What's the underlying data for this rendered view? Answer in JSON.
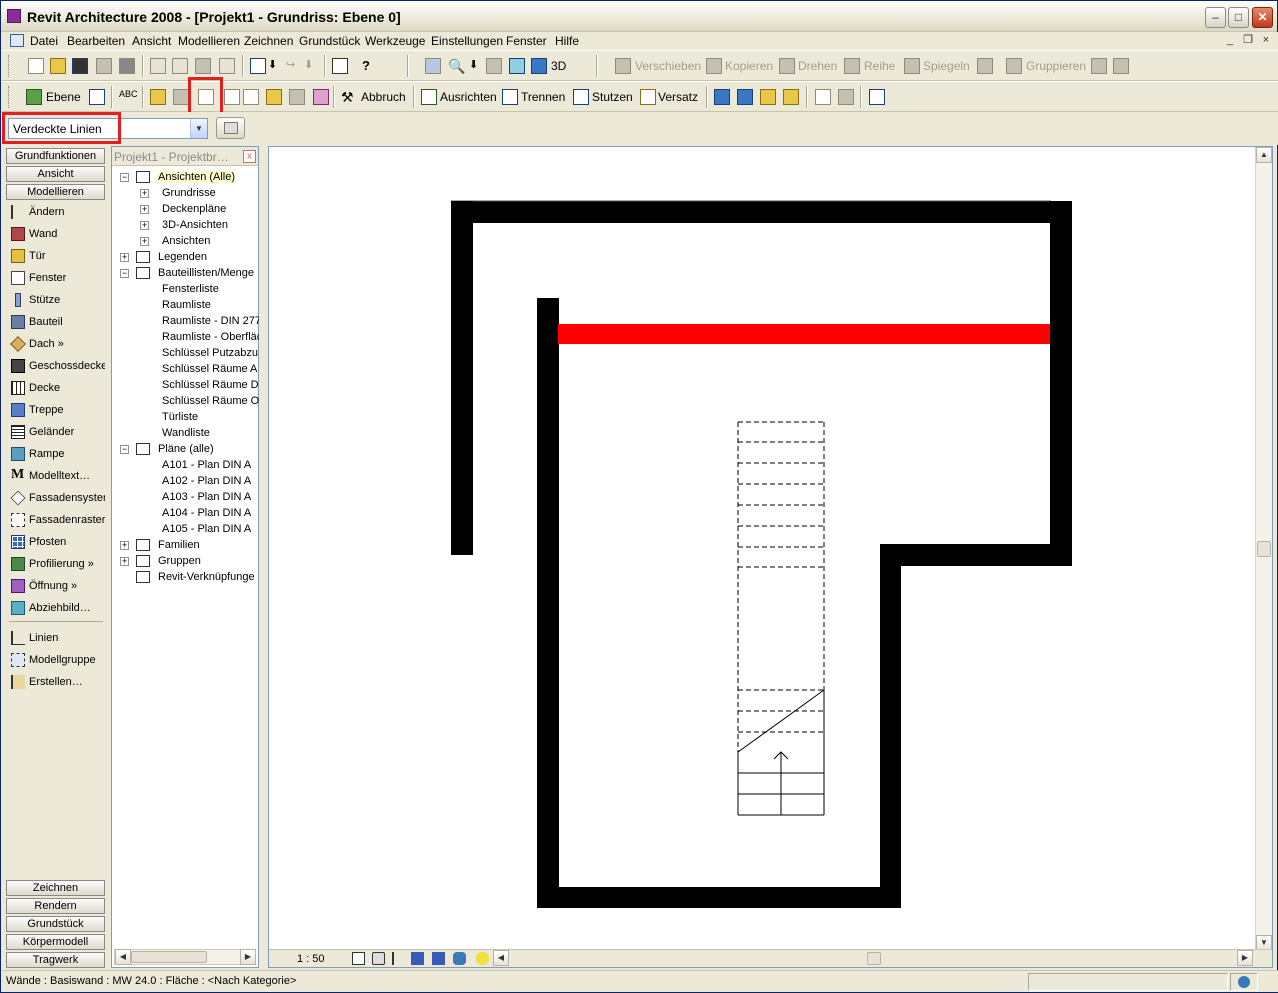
{
  "window": {
    "title": "Revit Architecture 2008 - [Projekt1 - Grundriss: Ebene 0]",
    "min_symbol": "–",
    "max_symbol": "□",
    "close_symbol": "✕"
  },
  "menu": {
    "items": [
      "Datei",
      "Bearbeiten",
      "Ansicht",
      "Modellieren",
      "Zeichnen",
      "Grundstück",
      "Werkzeuge",
      "Einstellungen",
      "Fenster",
      "Hilfe"
    ],
    "mdi_min": "_",
    "mdi_restore": "❐",
    "mdi_close": "×"
  },
  "toolbar1": {
    "view3d": "3D",
    "move": "Verschieben",
    "copy": "Kopieren",
    "rotate": "Drehen",
    "array": "Reihe",
    "mirror": "Spiegeln",
    "group": "Gruppieren"
  },
  "toolbar2": {
    "level": "Ebene",
    "cut": "Abbruch",
    "align": "Ausrichten",
    "split": "Trennen",
    "trim": "Stutzen",
    "offset": "Versatz"
  },
  "type_selector": {
    "value": "Verdeckte Linien",
    "arrow": "▼"
  },
  "design_bar": {
    "tabs_top": [
      "Grundfunktionen",
      "Ansicht",
      "Modellieren"
    ],
    "items": [
      {
        "label": "Ändern",
        "icon": "cursor-arrow-icon"
      },
      {
        "label": "Wand",
        "icon": "wall-icon"
      },
      {
        "label": "Tür",
        "icon": "door-icon"
      },
      {
        "label": "Fenster",
        "icon": "window-icon"
      },
      {
        "label": "Stütze",
        "icon": "column-icon"
      },
      {
        "label": "Bauteil",
        "icon": "component-icon"
      },
      {
        "label": "Dach »",
        "icon": "roof-icon"
      },
      {
        "label": "Geschossdecke",
        "icon": "floor-icon"
      },
      {
        "label": "Decke",
        "icon": "ceiling-icon"
      },
      {
        "label": "Treppe",
        "icon": "stair-icon"
      },
      {
        "label": "Geländer",
        "icon": "railing-icon"
      },
      {
        "label": "Rampe",
        "icon": "ramp-icon"
      },
      {
        "label": "Modelltext…",
        "icon": "model-text-icon"
      },
      {
        "label": "Fassadensyster",
        "icon": "curtain-system-icon"
      },
      {
        "label": "Fassadenraster",
        "icon": "curtain-grid-icon"
      },
      {
        "label": "Pfosten",
        "icon": "mullion-icon"
      },
      {
        "label": "Profilierung »",
        "icon": "host-sweep-icon"
      },
      {
        "label": "Öffnung »",
        "icon": "opening-icon"
      },
      {
        "label": "Abziehbild…",
        "icon": "decal-icon"
      },
      {
        "label": "Linien",
        "icon": "lines-icon"
      },
      {
        "label": "Modellgruppe",
        "icon": "model-group-icon"
      },
      {
        "label": "Erstellen…",
        "icon": "create-icon"
      }
    ],
    "model_text_glyph": "M",
    "tabs_bottom": [
      "Zeichnen",
      "Rendern",
      "Grundstück",
      "Körpermodell",
      "Tragwerk"
    ]
  },
  "browser": {
    "title": "Projekt1 - Projektbr…",
    "close": "x",
    "plus": "+",
    "minus": "−",
    "tree": [
      {
        "label": "Ansichten (Alle)",
        "level": 0,
        "state": "open",
        "icon": "eye-icon"
      },
      {
        "label": "Grundrisse",
        "level": 1,
        "state": "closed"
      },
      {
        "label": "Deckenpläne",
        "level": 1,
        "state": "closed"
      },
      {
        "label": "3D-Ansichten",
        "level": 1,
        "state": "closed"
      },
      {
        "label": "Ansichten",
        "level": 1,
        "state": "closed"
      },
      {
        "label": "Legenden",
        "level": 0,
        "state": "closed",
        "icon": "legend-icon"
      },
      {
        "label": "Bauteillisten/Menge",
        "level": 0,
        "state": "open",
        "icon": "schedule-icon"
      },
      {
        "label": "Fensterliste",
        "level": 1,
        "state": "leaf"
      },
      {
        "label": "Raumliste",
        "level": 1,
        "state": "leaf"
      },
      {
        "label": "Raumliste - DIN 277",
        "level": 1,
        "state": "leaf"
      },
      {
        "label": "Raumliste - Oberfläc",
        "level": 1,
        "state": "leaf"
      },
      {
        "label": "Schlüssel Putzabzu",
        "level": 1,
        "state": "leaf"
      },
      {
        "label": "Schlüssel Räume A",
        "level": 1,
        "state": "leaf"
      },
      {
        "label": "Schlüssel Räume D",
        "level": 1,
        "state": "leaf"
      },
      {
        "label": "Schlüssel Räume O",
        "level": 1,
        "state": "leaf"
      },
      {
        "label": "Türliste",
        "level": 1,
        "state": "leaf"
      },
      {
        "label": "Wandliste",
        "level": 1,
        "state": "leaf"
      },
      {
        "label": "Pläne (alle)",
        "level": 0,
        "state": "open",
        "icon": "sheet-icon"
      },
      {
        "label": "A101 - Plan DIN A",
        "level": 1,
        "state": "leaf"
      },
      {
        "label": "A102 - Plan DIN A",
        "level": 1,
        "state": "leaf"
      },
      {
        "label": "A103 - Plan DIN A",
        "level": 1,
        "state": "leaf"
      },
      {
        "label": "A104 - Plan DIN A",
        "level": 1,
        "state": "leaf"
      },
      {
        "label": "A105 - Plan DIN A",
        "level": 1,
        "state": "leaf"
      },
      {
        "label": "Familien",
        "level": 0,
        "state": "closed",
        "icon": "family-icon"
      },
      {
        "label": "Gruppen",
        "level": 0,
        "state": "closed",
        "icon": "group-icon"
      },
      {
        "label": "Revit-Verknüpfunge",
        "level": 0,
        "state": "none",
        "icon": "link-icon"
      }
    ]
  },
  "view": {
    "scale": "1 : 50"
  },
  "scroll": {
    "up": "▲",
    "down": "▼",
    "left": "◀",
    "right": "▶"
  },
  "status": {
    "text": "Wände : Basiswand : MW 24.0 : Fläche : <Nach Kategorie>"
  },
  "colors": {
    "highlight": "#e02020",
    "wall": "#000000",
    "selected_wall": "#ff0000"
  }
}
